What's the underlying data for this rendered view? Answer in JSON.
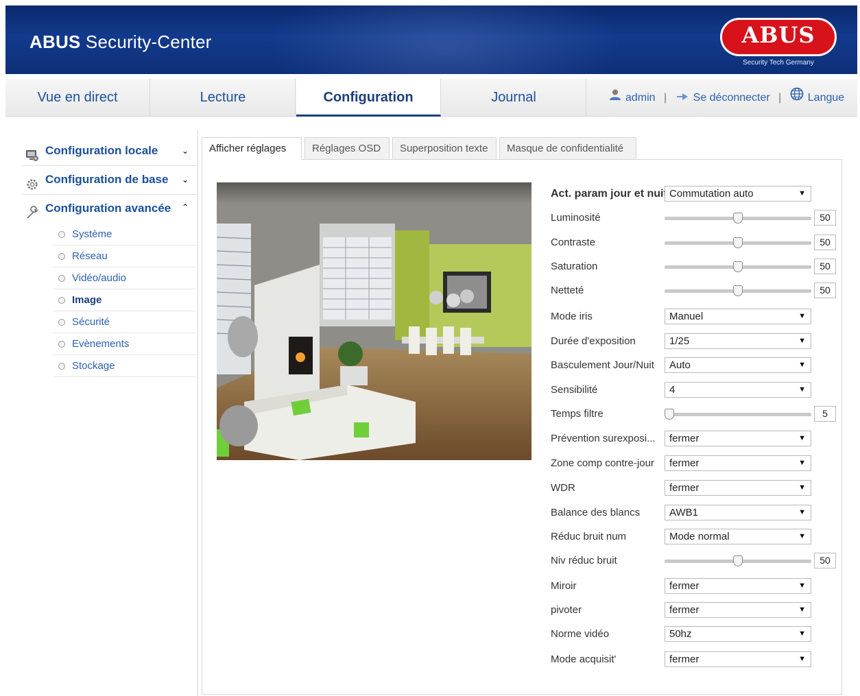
{
  "header": {
    "brand_bold": "ABUS",
    "brand_rest": "Security-Center",
    "logo_text": "ABUS",
    "logo_subtitle": "Security Tech Germany"
  },
  "nav": {
    "tabs": [
      {
        "label": "Vue en direct"
      },
      {
        "label": "Lecture"
      },
      {
        "label": "Configuration"
      },
      {
        "label": "Journal"
      }
    ],
    "active_tab": "Configuration",
    "user": "admin",
    "logout": "Se déconnecter",
    "language": "Langue"
  },
  "sidebar": {
    "sections": [
      {
        "label": "Configuration locale",
        "icon": "local-config-icon",
        "expanded": false
      },
      {
        "label": "Configuration de base",
        "icon": "gear-icon",
        "expanded": false
      },
      {
        "label": "Configuration avancée",
        "icon": "wrench-icon",
        "expanded": true
      }
    ],
    "items": [
      {
        "label": "Système"
      },
      {
        "label": "Réseau"
      },
      {
        "label": "Vidéo/audio"
      },
      {
        "label": "Image"
      },
      {
        "label": "Sécurité"
      },
      {
        "label": "Evènements"
      },
      {
        "label": "Stockage"
      }
    ],
    "active_item": "Image"
  },
  "subtabs": [
    {
      "label": "Afficher réglages"
    },
    {
      "label": "Réglages OSD"
    },
    {
      "label": "Superposition texte"
    },
    {
      "label": "Masque de confidentialité"
    }
  ],
  "settings": {
    "day_night_param": {
      "label": "Act. param jour et nuit",
      "value": "Commutation auto"
    },
    "luminosite": {
      "label": "Luminosité",
      "value": 50,
      "fraction": 0.5
    },
    "contraste": {
      "label": "Contraste",
      "value": 50,
      "fraction": 0.5
    },
    "saturation": {
      "label": "Saturation",
      "value": 50,
      "fraction": 0.5
    },
    "nettete": {
      "label": "Netteté",
      "value": 50,
      "fraction": 0.5
    },
    "mode_iris": {
      "label": "Mode iris",
      "value": "Manuel"
    },
    "duree_exposition": {
      "label": "Durée d'exposition",
      "value": "1/25"
    },
    "basculement": {
      "label": "Basculement Jour/Nuit",
      "value": "Auto"
    },
    "sensibilite": {
      "label": "Sensibilité",
      "value": "4"
    },
    "temps_filtre": {
      "label": "Temps filtre",
      "value": 5,
      "fraction": 0.0
    },
    "prevention": {
      "label": "Prévention surexposi...",
      "value": "fermer"
    },
    "zone_comp": {
      "label": "Zone comp contre-jour",
      "value": "fermer"
    },
    "wdr": {
      "label": "WDR",
      "value": "fermer"
    },
    "balance": {
      "label": "Balance des blancs",
      "value": "AWB1"
    },
    "reduc_bruit": {
      "label": "Réduc bruit num",
      "value": "Mode normal"
    },
    "niv_reduc": {
      "label": "Niv réduc bruit",
      "value": 50,
      "fraction": 0.5
    },
    "miroir": {
      "label": "Miroir",
      "value": "fermer"
    },
    "pivoter": {
      "label": "pivoter",
      "value": "fermer"
    },
    "norme_video": {
      "label": "Norme vidéo",
      "value": "50hz"
    },
    "mode_acquisit": {
      "label": "Mode acquisit'",
      "value": "fermer"
    }
  }
}
